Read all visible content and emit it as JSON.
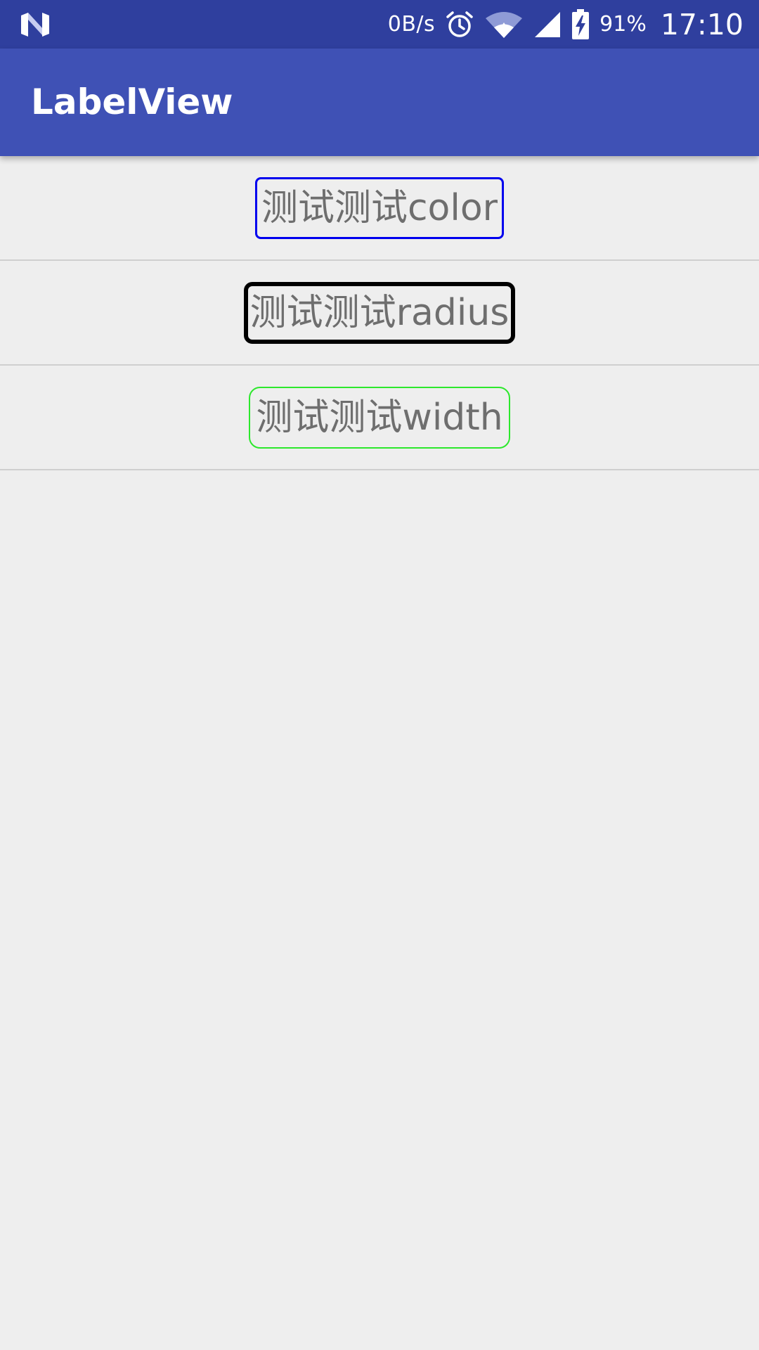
{
  "status_bar": {
    "net_speed": "0B/s",
    "battery_percent": "91%",
    "time": "17:10",
    "icons": [
      "n-logo-icon",
      "alarm-clock-icon",
      "wifi-icon",
      "cell-signal-icon",
      "battery-charging-icon"
    ]
  },
  "app_bar": {
    "title": "LabelView"
  },
  "labels": [
    {
      "text": "测试测试color",
      "border_color": "#0000ee"
    },
    {
      "text": "测试测试radius",
      "border_color": "#000000"
    },
    {
      "text": "测试测试width",
      "border_color": "#2ce82c"
    }
  ],
  "colors": {
    "status_bar": "#2f3f9e",
    "app_bar": "#3f51b5",
    "background": "#eeeeee",
    "label_text": "#6e6e6e",
    "divider": "#cfcfcf"
  }
}
